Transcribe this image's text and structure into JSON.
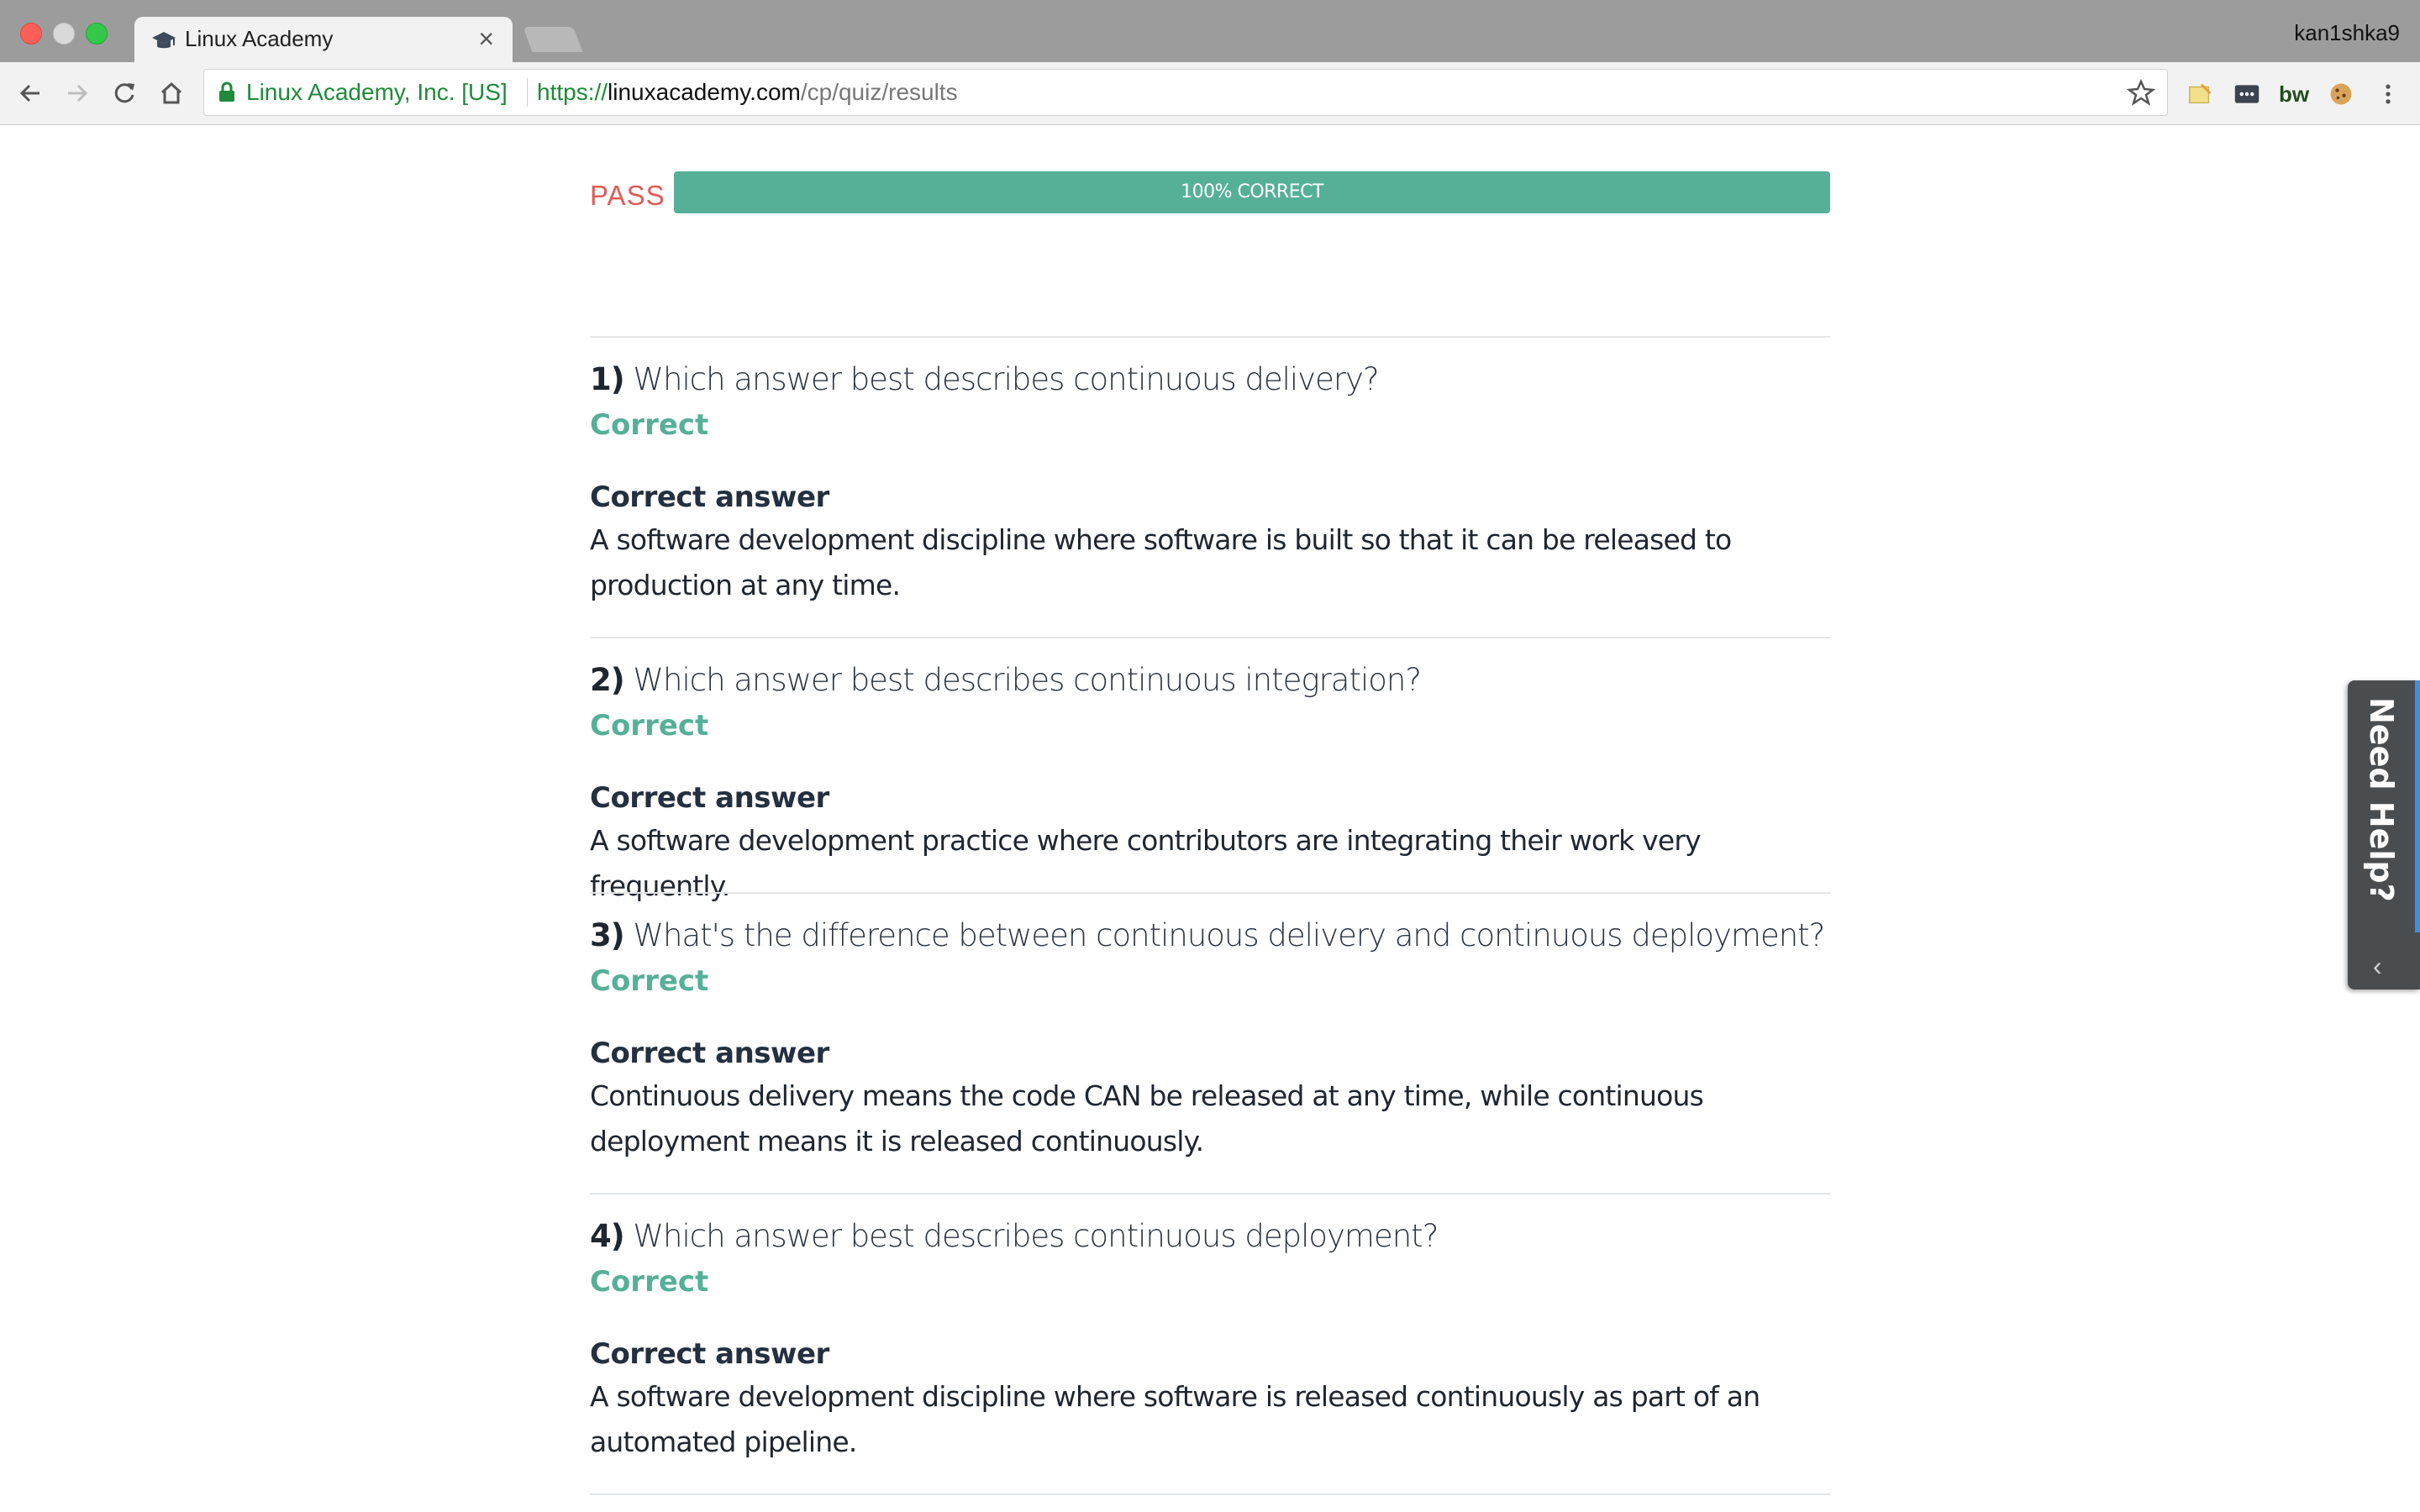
{
  "browser": {
    "tab_title": "Linux Academy",
    "tab_close": "×",
    "profile_name": "kan1shka9",
    "site_identity": "Linux Academy, Inc. [US]",
    "url_scheme": "https://",
    "url_host": "linuxacademy.com",
    "url_path": "/cp/quiz/results",
    "extensions": [
      "note-icon",
      "password-manager-icon",
      "bw-icon",
      "cookie-icon"
    ],
    "ext_bw_label": "bw"
  },
  "result": {
    "status": "PASS",
    "progress_label": "100% CORRECT",
    "progress_fraction": 1.0,
    "status_color": "#e05c57",
    "fill_color": "#56b098"
  },
  "questions": [
    {
      "number": "1)",
      "text": "Which answer best describes continuous delivery?",
      "status": "Correct",
      "answer_heading": "Correct answer",
      "answer": "A software development discipline where software is built so that it can be released to production at any time."
    },
    {
      "number": "2)",
      "text": "Which answer best describes continuous integration?",
      "status": "Correct",
      "answer_heading": "Correct answer",
      "answer": "A software development practice where contributors are integrating their work very frequently."
    },
    {
      "number": "3)",
      "text": "What's the difference between continuous delivery and continuous deployment?",
      "status": "Correct",
      "answer_heading": "Correct answer",
      "answer": "Continuous delivery means the code CAN be released at any time, while continuous deployment means it is released continuously."
    },
    {
      "number": "4)",
      "text": "Which answer best describes continuous deployment?",
      "status": "Correct",
      "answer_heading": "Correct answer",
      "answer": "A software development discipline where software is released continuously as part of an automated pipeline."
    }
  ],
  "help": {
    "label": "Need Help?",
    "chevron": "‹"
  }
}
